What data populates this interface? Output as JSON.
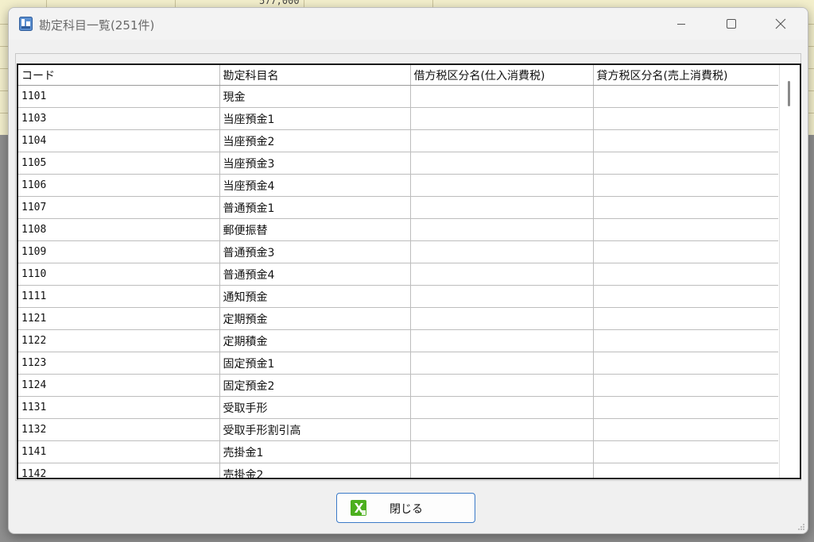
{
  "background": {
    "partial_value": "577,000"
  },
  "window": {
    "title": "勘定科目一覧(251件)"
  },
  "table": {
    "columns": [
      "コード",
      "勘定科目名",
      "借方税区分名(仕入消費税)",
      "貸方税区分名(売上消費税)"
    ],
    "rows": [
      {
        "code": "1101",
        "name": "現金",
        "debit_tax": "",
        "credit_tax": ""
      },
      {
        "code": "1103",
        "name": "当座預金1",
        "debit_tax": "",
        "credit_tax": ""
      },
      {
        "code": "1104",
        "name": "当座預金2",
        "debit_tax": "",
        "credit_tax": ""
      },
      {
        "code": "1105",
        "name": "当座預金3",
        "debit_tax": "",
        "credit_tax": ""
      },
      {
        "code": "1106",
        "name": "当座預金4",
        "debit_tax": "",
        "credit_tax": ""
      },
      {
        "code": "1107",
        "name": "普通預金1",
        "debit_tax": "",
        "credit_tax": ""
      },
      {
        "code": "1108",
        "name": "郵便振替",
        "debit_tax": "",
        "credit_tax": ""
      },
      {
        "code": "1109",
        "name": "普通預金3",
        "debit_tax": "",
        "credit_tax": ""
      },
      {
        "code": "1110",
        "name": "普通預金4",
        "debit_tax": "",
        "credit_tax": ""
      },
      {
        "code": "1111",
        "name": "通知預金",
        "debit_tax": "",
        "credit_tax": ""
      },
      {
        "code": "1121",
        "name": "定期預金",
        "debit_tax": "",
        "credit_tax": ""
      },
      {
        "code": "1122",
        "name": "定期積金",
        "debit_tax": "",
        "credit_tax": ""
      },
      {
        "code": "1123",
        "name": "固定預金1",
        "debit_tax": "",
        "credit_tax": ""
      },
      {
        "code": "1124",
        "name": "固定預金2",
        "debit_tax": "",
        "credit_tax": ""
      },
      {
        "code": "1131",
        "name": "受取手形",
        "debit_tax": "",
        "credit_tax": ""
      },
      {
        "code": "1132",
        "name": "受取手形割引高",
        "debit_tax": "",
        "credit_tax": ""
      },
      {
        "code": "1141",
        "name": "売掛金1",
        "debit_tax": "",
        "credit_tax": ""
      },
      {
        "code": "1142",
        "name": "売掛金2",
        "debit_tax": "",
        "credit_tax": ""
      }
    ]
  },
  "footer": {
    "close_label": "閉じる"
  },
  "icons": {
    "app": "app-icon",
    "minimize": "minimize-icon",
    "maximize": "maximize-icon",
    "close": "close-icon",
    "excel": "excel-icon"
  },
  "colors": {
    "accent_border": "#3b7ac8",
    "excel_green": "#4caf1e",
    "grid_border": "#1a1a1a"
  }
}
